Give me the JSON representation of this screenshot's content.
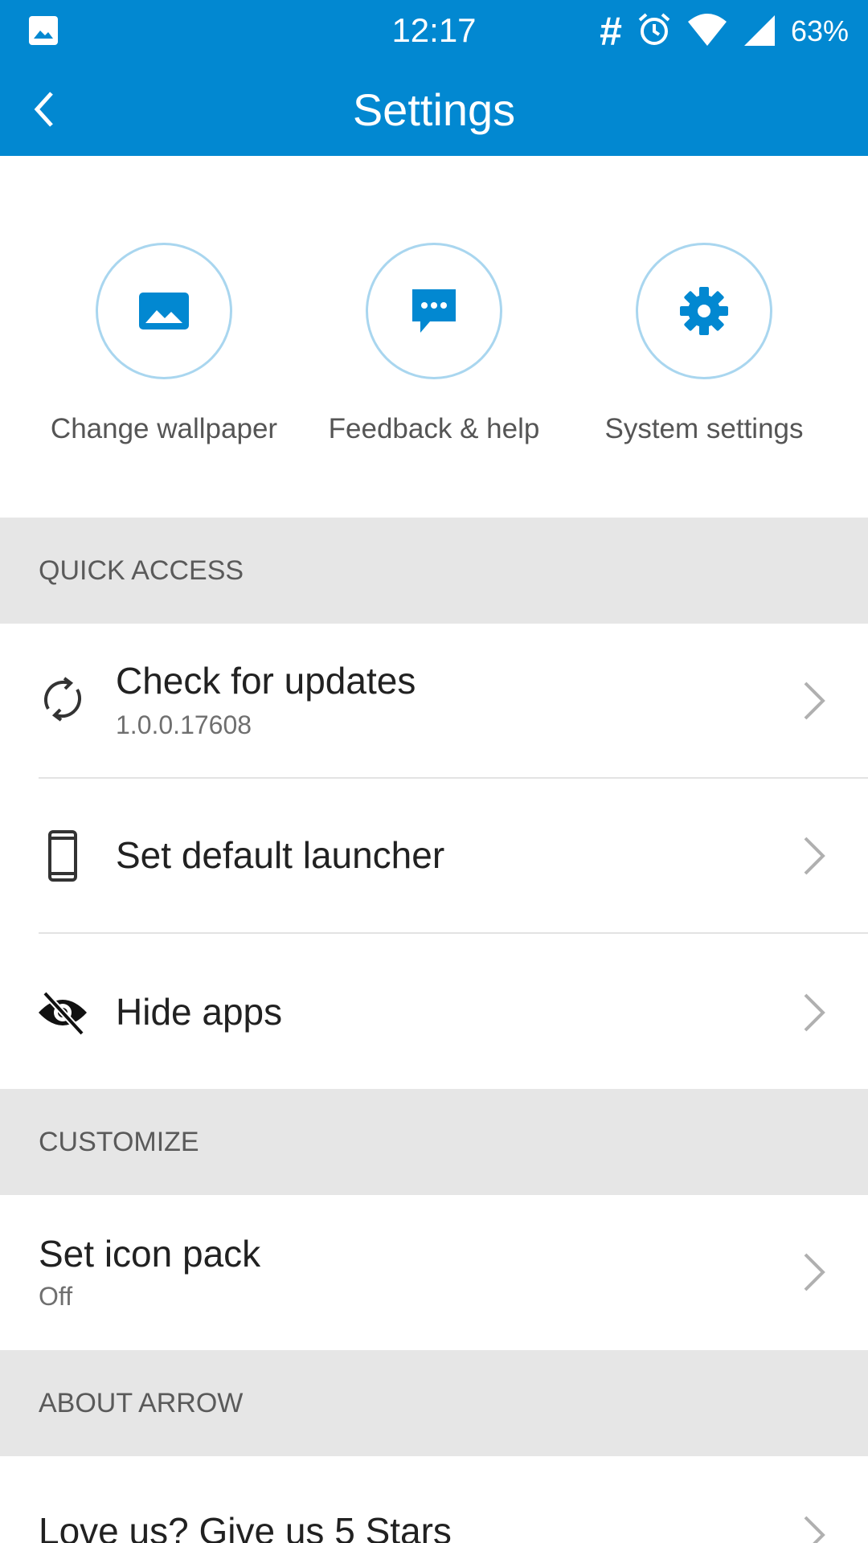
{
  "status_bar": {
    "time": "12:17",
    "hash_symbol": "#",
    "battery": "63%",
    "icons": [
      "image-icon",
      "alarm-icon",
      "wifi-icon",
      "signal-icon"
    ]
  },
  "app_bar": {
    "title": "Settings",
    "back_icon": "back-arrow-icon"
  },
  "quick_actions": [
    {
      "label": "Change wallpaper",
      "icon": "wallpaper-icon"
    },
    {
      "label": "Feedback & help",
      "icon": "chat-bubble-icon"
    },
    {
      "label": "System settings",
      "icon": "gear-icon"
    }
  ],
  "sections": {
    "quick_access": {
      "header": "QUICK ACCESS",
      "items": [
        {
          "title": "Check for updates",
          "subtitle": "1.0.0.17608",
          "icon": "refresh-icon"
        },
        {
          "title": "Set default launcher",
          "icon": "phone-icon"
        },
        {
          "title": "Hide apps",
          "icon": "eye-off-icon"
        }
      ]
    },
    "customize": {
      "header": "CUSTOMIZE",
      "items": [
        {
          "title": "Set icon pack",
          "subtitle": "Off"
        }
      ]
    },
    "about": {
      "header": "ABOUT ARROW",
      "items": [
        {
          "title": "Love us? Give us 5 Stars"
        }
      ]
    }
  },
  "colors": {
    "primary": "#0288d1",
    "section_bg": "#e6e6e6",
    "circle_border": "#a9d6ef",
    "chevron": "#b0b0b0"
  }
}
